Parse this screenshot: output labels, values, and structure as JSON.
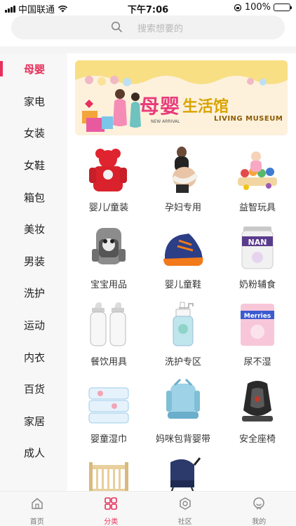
{
  "status": {
    "carrier": "中国联通",
    "time": "下午7:06",
    "battery": "100%"
  },
  "search": {
    "placeholder": "搜索想要的"
  },
  "sidebar": {
    "items": [
      {
        "label": "母婴",
        "active": true
      },
      {
        "label": "家电"
      },
      {
        "label": "女装"
      },
      {
        "label": "女鞋"
      },
      {
        "label": "箱包"
      },
      {
        "label": "美妆"
      },
      {
        "label": "男装"
      },
      {
        "label": "洗护"
      },
      {
        "label": "运动"
      },
      {
        "label": "内衣"
      },
      {
        "label": "百货"
      },
      {
        "label": "家居"
      },
      {
        "label": "成人"
      }
    ]
  },
  "banner": {
    "title_a": "母婴",
    "title_b": "生活馆",
    "subtitle": "LIVING MUSEUM",
    "tag": "NEW ARRIVAL"
  },
  "categories": [
    {
      "label": "婴儿/童装",
      "icon": "baby-clothes-icon"
    },
    {
      "label": "孕妇专用",
      "icon": "maternity-icon"
    },
    {
      "label": "益智玩具",
      "icon": "toy-icon"
    },
    {
      "label": "宝宝用品",
      "icon": "baby-carrier-icon"
    },
    {
      "label": "婴儿童鞋",
      "icon": "kids-shoe-icon"
    },
    {
      "label": "奶粉辅食",
      "icon": "formula-icon"
    },
    {
      "label": "餐饮用具",
      "icon": "bottle-icon"
    },
    {
      "label": "洗护专区",
      "icon": "lotion-icon"
    },
    {
      "label": "尿不湿",
      "icon": "diaper-icon"
    },
    {
      "label": "婴童湿巾",
      "icon": "wipes-icon"
    },
    {
      "label": "妈咪包背婴带",
      "icon": "sling-icon"
    },
    {
      "label": "安全座椅",
      "icon": "car-seat-icon"
    },
    {
      "label": "",
      "icon": "crib-icon"
    },
    {
      "label": "",
      "icon": "stroller-icon"
    }
  ],
  "tabbar": {
    "items": [
      {
        "label": "首页",
        "icon": "home-icon"
      },
      {
        "label": "分类",
        "icon": "category-icon",
        "active": true
      },
      {
        "label": "社区",
        "icon": "community-icon"
      },
      {
        "label": "我的",
        "icon": "profile-icon"
      }
    ]
  },
  "colors": {
    "accent": "#e8305c",
    "sidebar_bg": "#f7f7f7"
  }
}
